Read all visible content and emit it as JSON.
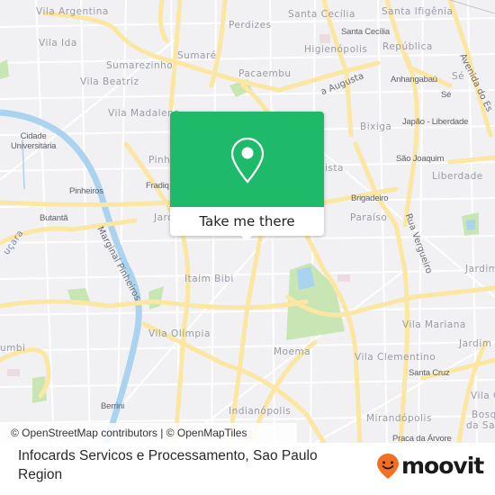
{
  "map": {
    "neighborhoods": [
      {
        "id": "vila-argentina",
        "label": "Vila Argentina"
      },
      {
        "id": "vila-ida",
        "label": "Vila Ida"
      },
      {
        "id": "sumarezinho",
        "label": "Sumarezinho"
      },
      {
        "id": "vila-beatriz",
        "label": "Vila Beatriz"
      },
      {
        "id": "vila-madalena",
        "label": "Vila Madalena"
      },
      {
        "id": "sumare",
        "label": "Sumaré"
      },
      {
        "id": "perdizes",
        "label": "Perdizes"
      },
      {
        "id": "pacaembu",
        "label": "Pacaembu"
      },
      {
        "id": "santa-cecilia",
        "label": "Santa Cecília"
      },
      {
        "id": "higienopolis",
        "label": "Higienópolis"
      },
      {
        "id": "santa-ifigenia",
        "label": "Santa Ifigênia"
      },
      {
        "id": "republica",
        "label": "República"
      },
      {
        "id": "se",
        "label": "Sé"
      },
      {
        "id": "bixiga",
        "label": "Bixiga"
      },
      {
        "id": "liberdade",
        "label": "Liberdade"
      },
      {
        "id": "paraiso",
        "label": "Paraíso"
      },
      {
        "id": "pinheiros-area",
        "label": "Pinh"
      },
      {
        "id": "jardim-area",
        "label": "Jard"
      },
      {
        "id": "paulista-area",
        "label": "ista"
      },
      {
        "id": "itaim-bibi",
        "label": "Itaim Bibi"
      },
      {
        "id": "vila-olimpia",
        "label": "Vila Olímpia"
      },
      {
        "id": "moema",
        "label": "Moema"
      },
      {
        "id": "vila-mariana",
        "label": "Vila Mariana"
      },
      {
        "id": "jardim-right",
        "label": "Jardim"
      },
      {
        "id": "jardim-right2",
        "label": "Jardim A"
      },
      {
        "id": "vila-clementino",
        "label": "Vila Clementino"
      },
      {
        "id": "indianopolis",
        "label": "Indianópolis"
      },
      {
        "id": "mirandopolis",
        "label": "Mirandópolis"
      },
      {
        "id": "vila-c",
        "label": "Vila C"
      },
      {
        "id": "bosque",
        "label": "Bosque"
      },
      {
        "id": "da-saude",
        "label": "da Saú"
      },
      {
        "id": "morumbi",
        "label": "umbi"
      }
    ],
    "stations": [
      {
        "id": "santa-cecilia-st",
        "label": "Santa Cecília"
      },
      {
        "id": "anhangabau",
        "label": "Anhangabaú"
      },
      {
        "id": "se-st",
        "label": "Sé"
      },
      {
        "id": "japao-liberdade",
        "label": "Japão - Liberdade"
      },
      {
        "id": "sao-joaquim",
        "label": "São Joaquim"
      },
      {
        "id": "brigadeiro",
        "label": "Brigadeiro"
      },
      {
        "id": "cidade-universitaria",
        "label": "Cidade\nUniversitária"
      },
      {
        "id": "pinheiros",
        "label": "Pinheiros"
      },
      {
        "id": "butanta",
        "label": "Butantã"
      },
      {
        "id": "fradique",
        "label": "Fradiq"
      },
      {
        "id": "berrini",
        "label": "Berrini"
      },
      {
        "id": "santa-cruz",
        "label": "Santa Cruz"
      },
      {
        "id": "praca-da-arvore",
        "label": "Praca da Árvore"
      }
    ],
    "roads": [
      {
        "id": "rua-augusta",
        "label": "a Augusta"
      },
      {
        "id": "avenida-do-estado",
        "label": "Avenida do Es"
      },
      {
        "id": "rua-vergueiro",
        "label": "Rua Vergueiro"
      },
      {
        "id": "marginal-pinheiros",
        "label": "Marginal Pinheiros"
      },
      {
        "id": "jucara",
        "label": "uçara"
      }
    ],
    "colors": {
      "background": "#f1f1f3",
      "major_road": "#fbe7a1",
      "minor_road": "#ffffff",
      "water": "#aad3f0",
      "park": "#c8e6b4"
    }
  },
  "popup": {
    "icon": "location-pin-icon",
    "action_label": "Take me there",
    "accent_color": "#1fb96a"
  },
  "attribution": {
    "text": "© OpenStreetMap contributors | © OpenMapTiles"
  },
  "footer": {
    "place_title": "Infocards Servicos e Processamento, Sao Paulo Region",
    "brand_name": "moovit",
    "brand_color": "#f36f21"
  }
}
